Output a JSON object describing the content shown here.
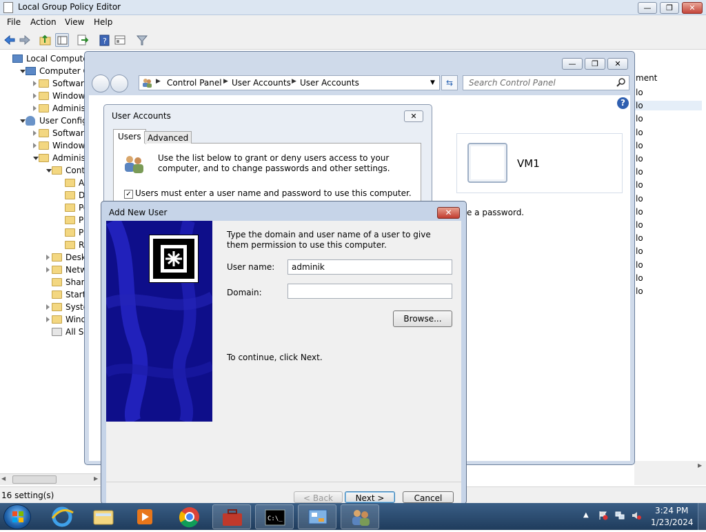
{
  "gpe": {
    "title": "Local Group Policy Editor",
    "window_min": "—",
    "window_max": "❐",
    "window_close": "✕",
    "menu": [
      "File",
      "Action",
      "View",
      "Help"
    ],
    "tree": [
      {
        "label": "Local Computer P",
        "indent": 0,
        "expander": "none",
        "icon": "pc"
      },
      {
        "label": "Computer Cor",
        "indent": 1,
        "expander": "down",
        "icon": "pc"
      },
      {
        "label": "Software Se",
        "indent": 2,
        "expander": "right",
        "icon": "folder"
      },
      {
        "label": "Windows S",
        "indent": 2,
        "expander": "right",
        "icon": "folder"
      },
      {
        "label": "Administra",
        "indent": 2,
        "expander": "right",
        "icon": "folder"
      },
      {
        "label": "User Configura",
        "indent": 1,
        "expander": "down",
        "icon": "user"
      },
      {
        "label": "Software Se",
        "indent": 2,
        "expander": "right",
        "icon": "folder"
      },
      {
        "label": "Windows S",
        "indent": 2,
        "expander": "right",
        "icon": "folder"
      },
      {
        "label": "Administra",
        "indent": 2,
        "expander": "down",
        "icon": "folder"
      },
      {
        "label": "Control",
        "indent": 3,
        "expander": "down",
        "icon": "folder"
      },
      {
        "label": "Add",
        "indent": 4,
        "expander": "none",
        "icon": "folder"
      },
      {
        "label": "Disp",
        "indent": 4,
        "expander": "none",
        "icon": "folder"
      },
      {
        "label": "Pers",
        "indent": 4,
        "expander": "none",
        "icon": "folder"
      },
      {
        "label": "Prin",
        "indent": 4,
        "expander": "none",
        "icon": "folder"
      },
      {
        "label": "Proc",
        "indent": 4,
        "expander": "none",
        "icon": "folder"
      },
      {
        "label": "Reg",
        "indent": 4,
        "expander": "none",
        "icon": "folder"
      },
      {
        "label": "Desktop",
        "indent": 3,
        "expander": "right",
        "icon": "folder"
      },
      {
        "label": "Networ",
        "indent": 3,
        "expander": "right",
        "icon": "folder"
      },
      {
        "label": "Shared",
        "indent": 3,
        "expander": "none",
        "icon": "folder"
      },
      {
        "label": "Start M",
        "indent": 3,
        "expander": "none",
        "icon": "folder"
      },
      {
        "label": "System",
        "indent": 3,
        "expander": "right",
        "icon": "folder"
      },
      {
        "label": "Window",
        "indent": 3,
        "expander": "right",
        "icon": "folder"
      },
      {
        "label": "All Setti",
        "indent": 3,
        "expander": "none",
        "icon": "settings"
      }
    ],
    "right_header": "ment",
    "right_rows": [
      "lo",
      "lo",
      "lo",
      "lo",
      "lo",
      "lo",
      "lo",
      "lo",
      "lo",
      "lo",
      "lo",
      "lo",
      "lo",
      "lo",
      "lo",
      "lo"
    ],
    "status": "16 setting(s)"
  },
  "control_panel": {
    "breadcrumb": [
      "Control Panel",
      "User Accounts",
      "User Accounts"
    ],
    "search_placeholder": "Search Control Panel",
    "help": "?",
    "account_name": "VM1",
    "password_note": "age a password."
  },
  "user_accounts": {
    "title": "User Accounts",
    "close": "✕",
    "tabs": [
      "Users",
      "Advanced"
    ],
    "description": "Use the list below to grant or deny users access to your computer, and to change passwords and other settings.",
    "check_mark": "✓",
    "checkbox_label": "Users must enter a user name and password to use this computer."
  },
  "add_new_user": {
    "title": "Add New User",
    "close": "✕",
    "instruction": "Type the domain and user name of a user to give them permission to use this computer.",
    "username_label": "User name:",
    "username_value": "adminik",
    "domain_label": "Domain:",
    "domain_value": "",
    "browse": "Browse...",
    "continue_text": "To continue, click Next.",
    "back": "< Back",
    "next": "Next >",
    "cancel": "Cancel"
  },
  "taskbar": {
    "time": "3:24 PM",
    "date": "1/23/2024"
  },
  "colors": {
    "banner": "#0e0e8a",
    "titlebar": "#dce6f2",
    "taskbar": "#2a4a70"
  }
}
